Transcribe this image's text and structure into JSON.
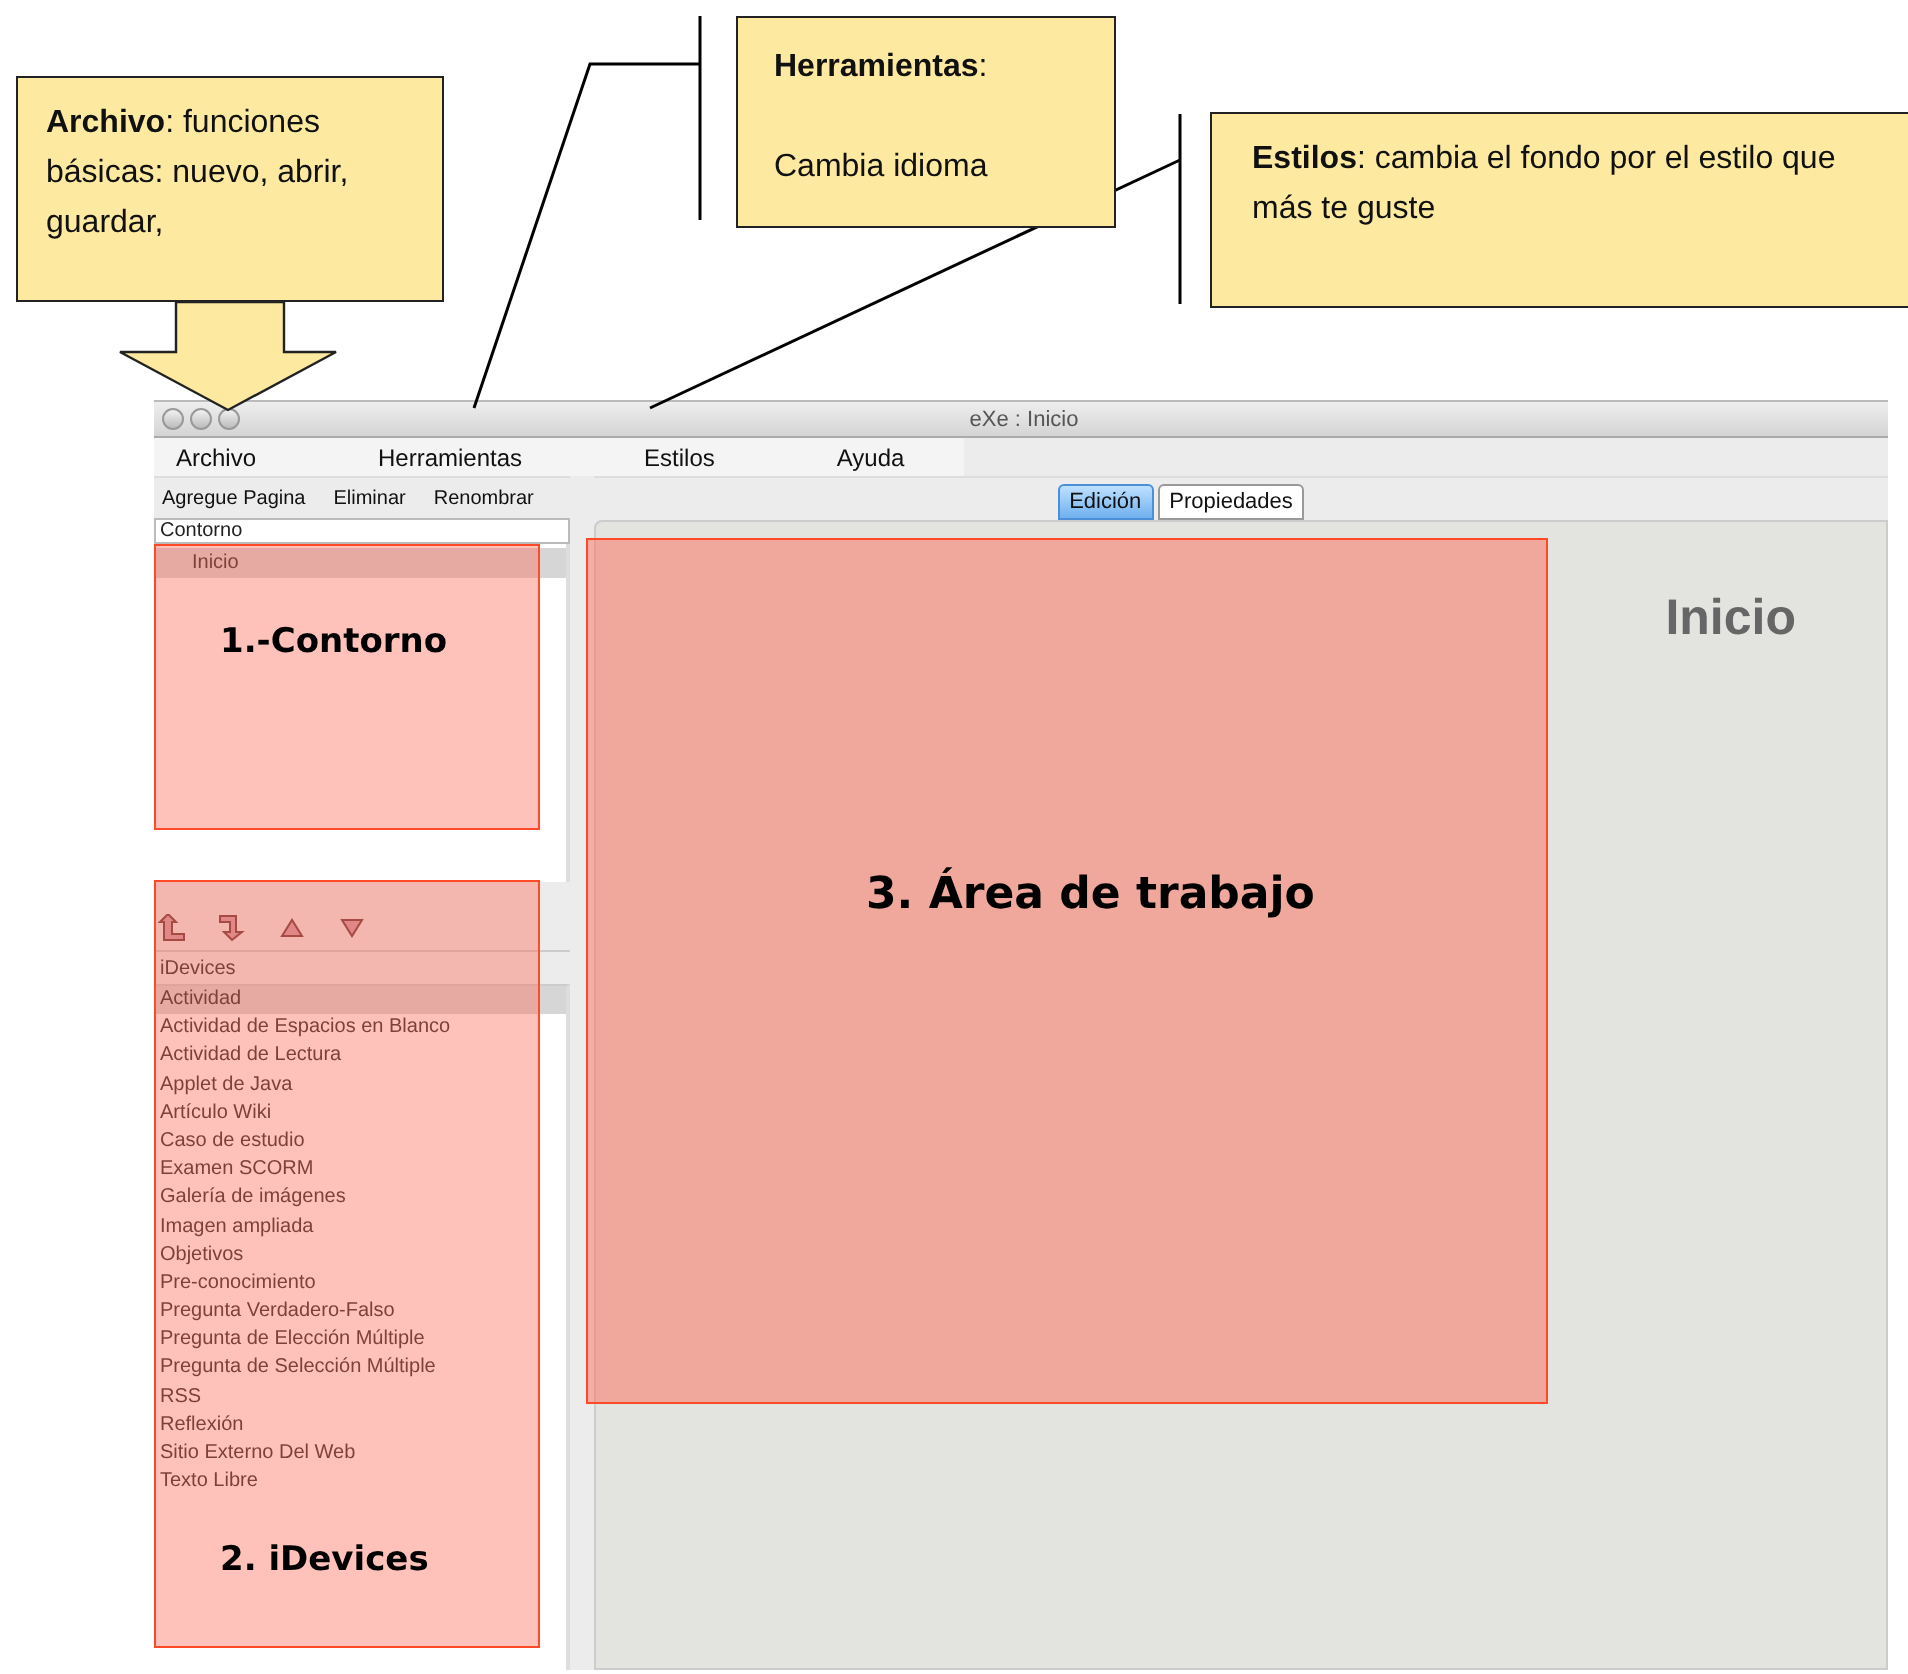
{
  "callouts": [
    {
      "kind": "arrow",
      "paragraphs": [
        "**Archivo**: funciones básicas: nuevo, abrir, guardar,"
      ]
    },
    {
      "kind": "bracket-bent",
      "paragraphs": [
        "**Herramientas**:",
        "Cambia idioma"
      ]
    },
    {
      "kind": "bracket-straight",
      "paragraphs": [
        "**Estilos**: cambia el fondo por el estilo que más te guste"
      ]
    }
  ],
  "window": {
    "title": "eXe : Inicio"
  },
  "menu": [
    "Archivo",
    "Herramientas",
    "Estilos",
    "Ayuda"
  ],
  "toolbar": [
    "Agregue Pagina",
    "Eliminar",
    "Renombrar"
  ],
  "outline": {
    "header": "Contorno",
    "items": [
      {
        "label": "Inicio",
        "selected": true
      }
    ]
  },
  "idevices": {
    "header": "iDevices",
    "items": [
      {
        "label": "Actividad",
        "selected": true
      },
      {
        "label": "Actividad de Espacios en Blanco",
        "selected": false
      },
      {
        "label": "Actividad de Lectura",
        "selected": false
      },
      {
        "label": "Applet de Java",
        "selected": false
      },
      {
        "label": "Artículo Wiki",
        "selected": false
      },
      {
        "label": "Caso de estudio",
        "selected": false
      },
      {
        "label": "Examen SCORM",
        "selected": false
      },
      {
        "label": "Galería de imágenes",
        "selected": false
      },
      {
        "label": "Imagen ampliada",
        "selected": false
      },
      {
        "label": "Objetivos",
        "selected": false
      },
      {
        "label": "Pre-conocimiento",
        "selected": false
      },
      {
        "label": "Pregunta Verdadero-Falso",
        "selected": false
      },
      {
        "label": "Pregunta de Elección Múltiple",
        "selected": false
      },
      {
        "label": "Pregunta de Selección Múltiple",
        "selected": false
      },
      {
        "label": "RSS",
        "selected": false
      },
      {
        "label": "Reflexión",
        "selected": false
      },
      {
        "label": "Sitio Externo Del Web",
        "selected": false
      },
      {
        "label": "Texto Libre",
        "selected": false
      }
    ]
  },
  "tabs": [
    {
      "label": "Edición",
      "selected": true
    },
    {
      "label": "Propiedades",
      "selected": false
    }
  ],
  "page_title": "Inicio",
  "regions": [
    {
      "label": "1.-Contorno"
    },
    {
      "label": "2. iDevices"
    },
    {
      "label": "3. Área de trabajo"
    }
  ]
}
